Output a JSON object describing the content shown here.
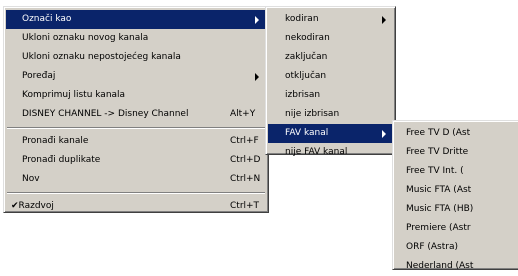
{
  "main_menu": {
    "items": [
      {
        "label": "Označi kao",
        "shortcut": "",
        "submenu": true
      },
      {
        "label": "Ukloni oznaku novog kanala",
        "shortcut": ""
      },
      {
        "label": "Ukloni oznaku nepostojećeg kanala",
        "shortcut": ""
      },
      {
        "label": "Poređaj",
        "shortcut": "",
        "submenu": true
      },
      {
        "label": "Komprimuj listu kanala",
        "shortcut": ""
      },
      {
        "label": "DISNEY CHANNEL -> Disney Channel",
        "shortcut": "Alt+Y"
      },
      {
        "label": "Pronađi kanale",
        "shortcut": "Ctrl+F"
      },
      {
        "label": "Pronađi duplikate",
        "shortcut": "Ctrl+D"
      },
      {
        "label": "Nov",
        "shortcut": "Ctrl+N"
      },
      {
        "label": "Razdvoj",
        "shortcut": "Ctrl+T",
        "check": "✔"
      }
    ]
  },
  "mark_submenu": {
    "items": [
      {
        "label": "kodiran",
        "submenu": true
      },
      {
        "label": "nekodiran"
      },
      {
        "label": "zaključan"
      },
      {
        "label": "otključan"
      },
      {
        "label": "izbrisan"
      },
      {
        "label": "nije izbrisan"
      },
      {
        "label": "FAV kanal",
        "submenu": true
      },
      {
        "label": "nije FAV kanal"
      }
    ]
  },
  "fav_submenu": {
    "items": [
      {
        "label": "Free TV D (Ast"
      },
      {
        "label": "Free TV Dritte"
      },
      {
        "label": "Free TV Int. ("
      },
      {
        "label": "Music FTA (Ast"
      },
      {
        "label": "Music FTA (HB)"
      },
      {
        "label": "Premiere (Astr"
      },
      {
        "label": "ORF (Astra)"
      },
      {
        "label": "Nederland (Ast"
      }
    ]
  }
}
